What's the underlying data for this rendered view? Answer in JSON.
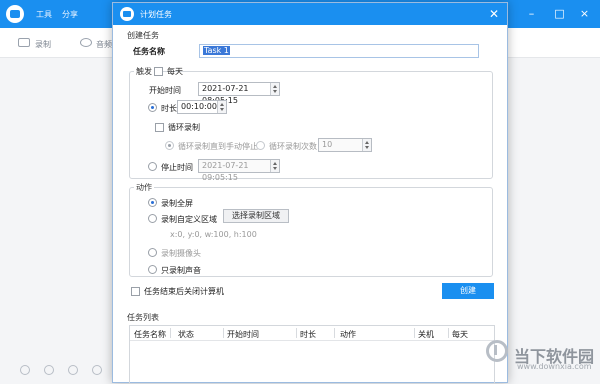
{
  "app": {
    "menu": [
      "工具",
      "分享"
    ],
    "toolbar": [
      "录制",
      "音频"
    ],
    "window_buttons": [
      "–",
      "□",
      "×"
    ]
  },
  "dialog": {
    "title": "计划任务",
    "close": "✕",
    "section_create": "创建任务",
    "task_name_label": "任务名称",
    "task_name_value": "Task 1",
    "trigger_label": "触发",
    "daily_label": "每天",
    "start_time_label": "开始时间",
    "start_time_value": "2021-07-21 08:05:15",
    "duration_label": "时长",
    "duration_value": "00:10:00",
    "loop_label": "循环录制",
    "loop_until_stop": "循环录制直到手动停止",
    "loop_count_label": "循环录制次数",
    "loop_count_value": "10",
    "stop_time_label": "停止时间",
    "stop_time_value": "2021-07-21 09:05:15",
    "action_label": "动作",
    "action_fullscreen": "录制全屏",
    "action_custom": "录制自定义区域",
    "select_area_button": "选择录制区域",
    "area_info": "x:0, y:0, w:100, h:100",
    "action_camera": "录制摄像头",
    "action_audio": "只录制声音",
    "shutdown_label": "任务结束后关闭计算机",
    "create_button": "创建",
    "task_list_label": "任务列表",
    "columns": [
      "任务名称",
      "状态",
      "开始时间",
      "时长",
      "动作",
      "关机",
      "每天"
    ]
  },
  "watermark": {
    "text": "当下软件园",
    "url": "www.downxia.com"
  },
  "colors": {
    "accent": "#1a8ff0"
  }
}
